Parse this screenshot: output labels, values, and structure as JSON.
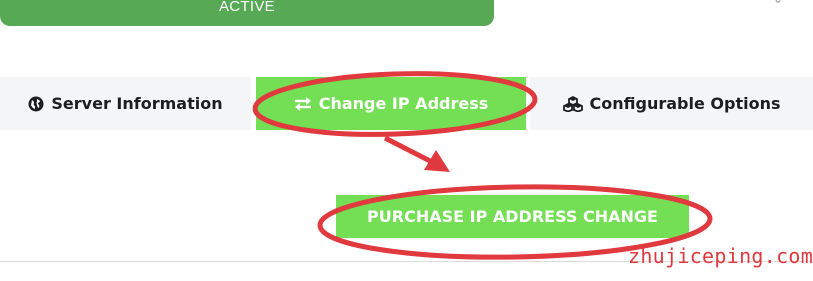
{
  "status": {
    "label": "ACTIVE",
    "color": "#58a956"
  },
  "tabs": [
    {
      "label": "Server Information",
      "icon": "globe-icon",
      "active": false
    },
    {
      "label": "Change IP Address",
      "icon": "exchange-arrows-icon",
      "active": true
    },
    {
      "label": "Configurable Options",
      "icon": "cubes-icon",
      "active": false
    }
  ],
  "purchase": {
    "label": "PURCHASE IP ADDRESS CHANGE"
  },
  "annotation": {
    "color": "#e0393e"
  },
  "watermark": {
    "text": "zhujiceping.com"
  },
  "colors": {
    "accent_green": "#74de55",
    "tab_bg": "#f3f5f7",
    "annotation_red": "#e0393e"
  }
}
